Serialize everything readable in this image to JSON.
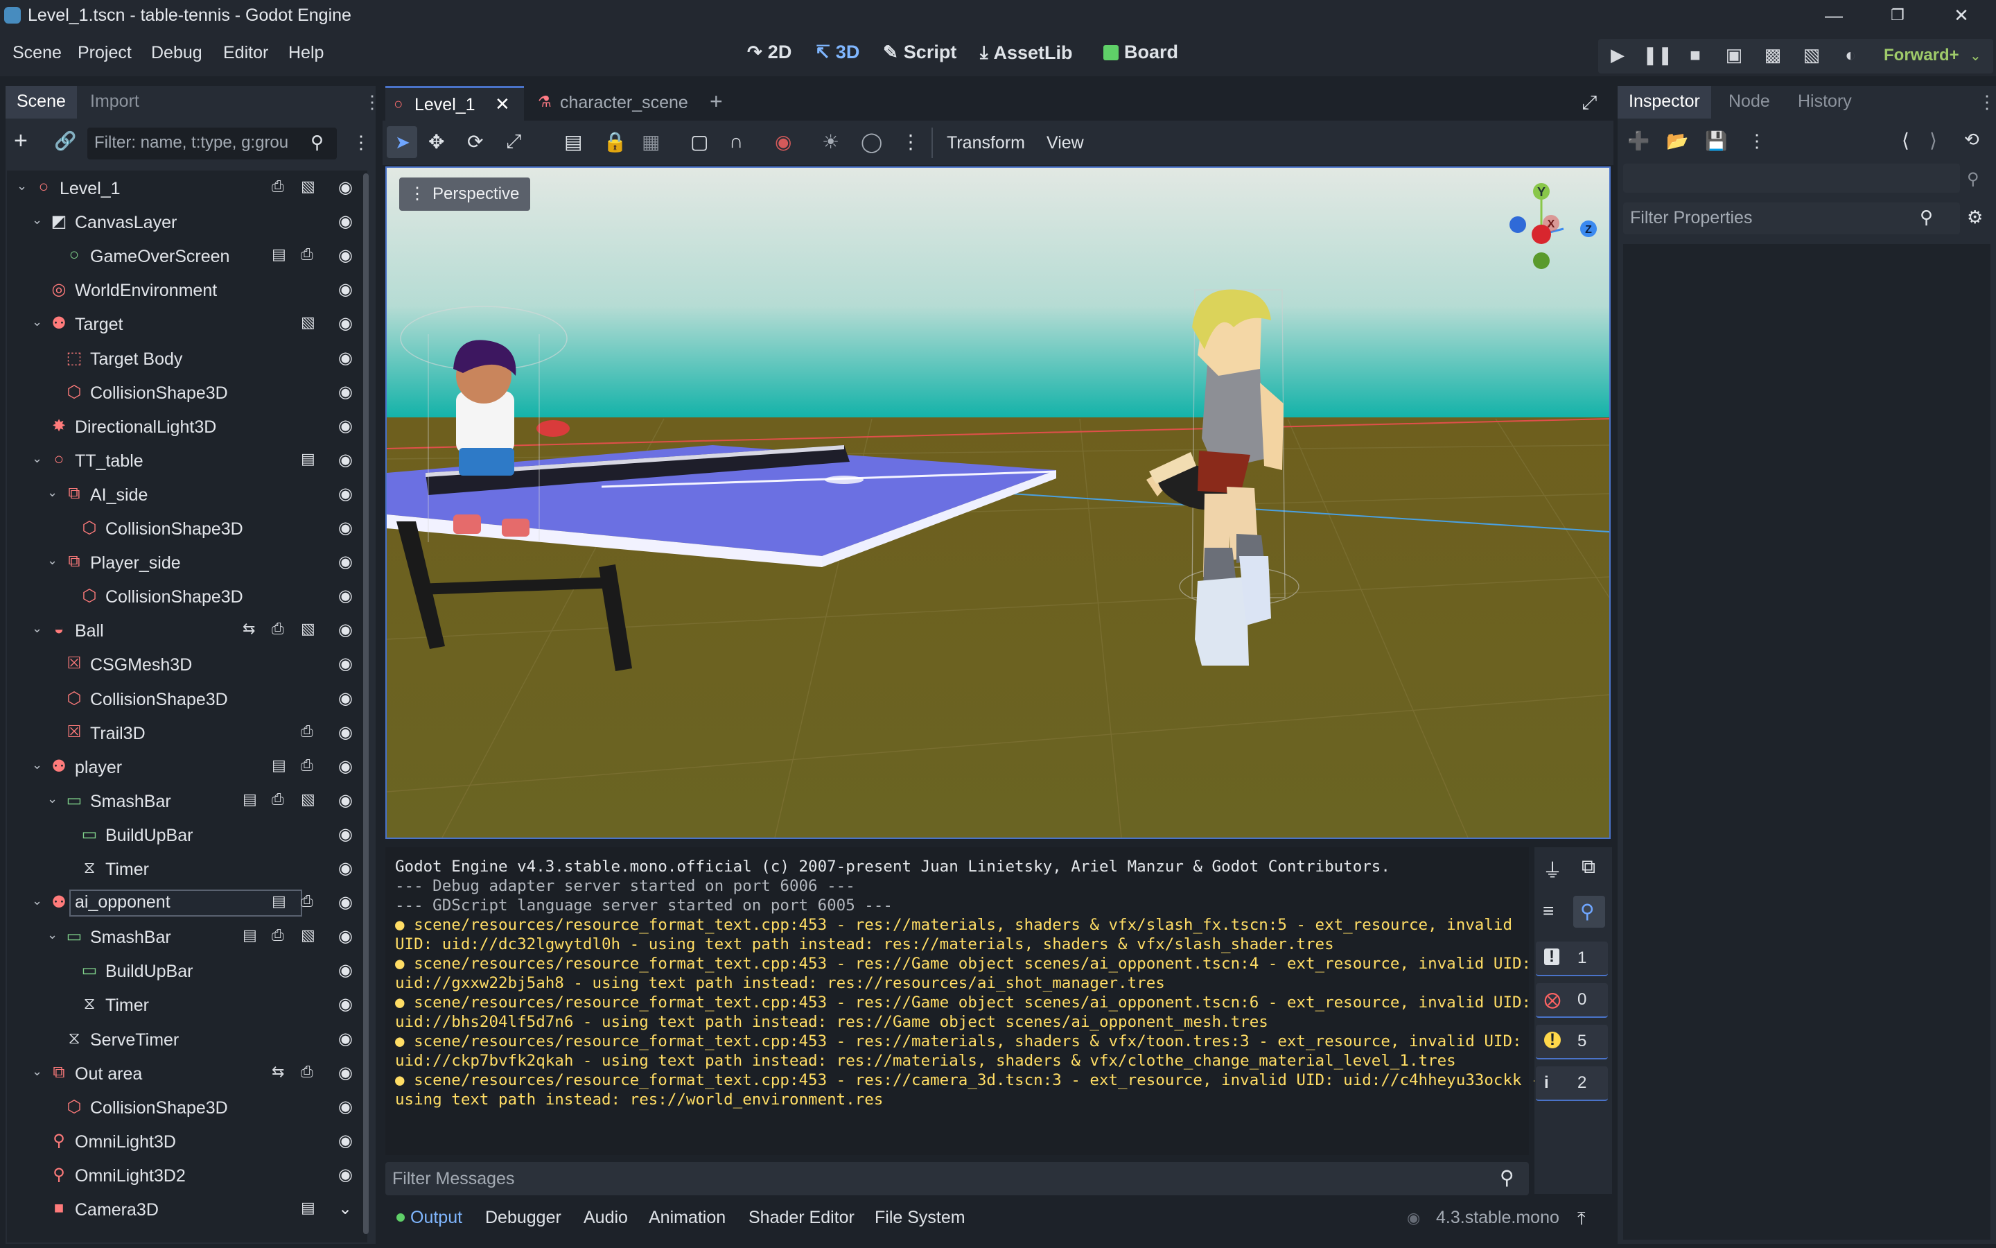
{
  "window": {
    "title": "Level_1.tscn - table-tennis - Godot Engine",
    "minimize_icon": "minimize-icon",
    "maximize_icon": "restore-icon",
    "close_icon": "close-icon"
  },
  "menus": [
    "Scene",
    "Project",
    "Debug",
    "Editor",
    "Help"
  ],
  "workspaces": [
    {
      "label": "2D",
      "icon": "2d-icon"
    },
    {
      "label": "3D",
      "icon": "3d-icon",
      "active": true
    },
    {
      "label": "Script",
      "icon": "script-icon"
    },
    {
      "label": "AssetLib",
      "icon": "assetlib-icon"
    },
    {
      "label": "Board",
      "icon": "board-icon"
    }
  ],
  "renderer": "Forward+",
  "scene_dock": {
    "tabs": [
      "Scene",
      "Import"
    ],
    "filter_placeholder": "Filter: name, t:type, g:grou",
    "tree": [
      {
        "label": "Level_1",
        "icon": "node3d-icon",
        "depth": 0,
        "expanded": true
      },
      {
        "label": "CanvasLayer",
        "icon": "canvaslayer-icon",
        "depth": 1,
        "expanded": true
      },
      {
        "label": "GameOverScreen",
        "icon": "control-icon",
        "depth": 2
      },
      {
        "label": "WorldEnvironment",
        "icon": "worldenv-icon",
        "depth": 1
      },
      {
        "label": "Target",
        "icon": "character-icon",
        "depth": 1,
        "expanded": true
      },
      {
        "label": "Target Body",
        "icon": "staticbody-icon",
        "depth": 2
      },
      {
        "label": "CollisionShape3D",
        "icon": "collision-icon",
        "depth": 2
      },
      {
        "label": "DirectionalLight3D",
        "icon": "light-icon",
        "depth": 1
      },
      {
        "label": "TT_table",
        "icon": "node3d-icon",
        "depth": 1,
        "expanded": true
      },
      {
        "label": "AI_side",
        "icon": "area-icon",
        "depth": 2,
        "expanded": true
      },
      {
        "label": "CollisionShape3D",
        "icon": "collision-icon",
        "depth": 3
      },
      {
        "label": "Player_side",
        "icon": "area-icon",
        "depth": 2,
        "expanded": true
      },
      {
        "label": "CollisionShape3D",
        "icon": "collision-icon",
        "depth": 3
      },
      {
        "label": "Ball",
        "icon": "rigidbody-icon",
        "depth": 1,
        "expanded": true
      },
      {
        "label": "CSGMesh3D",
        "icon": "csgmesh-icon",
        "depth": 2
      },
      {
        "label": "CollisionShape3D",
        "icon": "collision-icon",
        "depth": 2
      },
      {
        "label": "Trail3D",
        "icon": "trail-icon",
        "depth": 2
      },
      {
        "label": "player",
        "icon": "character-icon",
        "depth": 1,
        "expanded": true
      },
      {
        "label": "SmashBar",
        "icon": "progressbar-icon",
        "depth": 2,
        "expanded": true
      },
      {
        "label": "BuildUpBar",
        "icon": "progressbar-icon",
        "depth": 3
      },
      {
        "label": "Timer",
        "icon": "timer-icon",
        "depth": 3
      },
      {
        "label": "ai_opponent",
        "icon": "character-icon",
        "depth": 1,
        "expanded": true,
        "selected": true
      },
      {
        "label": "SmashBar",
        "icon": "progressbar-icon",
        "depth": 2,
        "expanded": true
      },
      {
        "label": "BuildUpBar",
        "icon": "progressbar-icon",
        "depth": 3
      },
      {
        "label": "Timer",
        "icon": "timer-icon",
        "depth": 3
      },
      {
        "label": "ServeTimer",
        "icon": "timer-icon",
        "depth": 2
      },
      {
        "label": "Out area",
        "icon": "area-icon",
        "depth": 1,
        "expanded": true
      },
      {
        "label": "CollisionShape3D",
        "icon": "collision-icon",
        "depth": 2
      },
      {
        "label": "OmniLight3D",
        "icon": "omnilight-icon",
        "depth": 1
      },
      {
        "label": "OmniLight3D2",
        "icon": "omnilight-icon",
        "depth": 1
      },
      {
        "label": "Camera3D",
        "icon": "camera-icon",
        "depth": 1
      }
    ]
  },
  "editor_tabs": [
    {
      "label": "Level_1",
      "active": true
    },
    {
      "label": "character_scene",
      "active": false
    }
  ],
  "viewport_toolbar": {
    "transform_menu": "Transform",
    "view_menu": "View"
  },
  "viewport": {
    "perspective_label": "Perspective",
    "gizmo_axes": [
      "Y",
      "X",
      "Z"
    ]
  },
  "output": {
    "lines": [
      {
        "text": "Godot Engine v4.3.stable.mono.official (c) 2007-present Juan Linietsky, Ariel Manzur & Godot Contributors.",
        "kind": "plain"
      },
      {
        "text": "--- Debug adapter server started on port 6006 ---",
        "kind": "dim"
      },
      {
        "text": "--- GDScript language server started on port 6005 ---",
        "kind": "dim"
      },
      {
        "text": "scene/resources/resource_format_text.cpp:453 - res://materials, shaders & vfx/slash_fx.tscn:5 - ext_resource, invalid",
        "kind": "warn",
        "bullet": true
      },
      {
        "text": "UID: uid://dc32lgwytdl0h - using text path instead: res://materials, shaders & vfx/slash_shader.tres",
        "kind": "warn"
      },
      {
        "text": "scene/resources/resource_format_text.cpp:453 - res://Game object scenes/ai_opponent.tscn:4 - ext_resource, invalid UID:",
        "kind": "warn",
        "bullet": true
      },
      {
        "text": "uid://gxxw22bj5ah8 - using text path instead: res://resources/ai_shot_manager.tres",
        "kind": "warn"
      },
      {
        "text": "scene/resources/resource_format_text.cpp:453 - res://Game object scenes/ai_opponent.tscn:6 - ext_resource, invalid UID:",
        "kind": "warn",
        "bullet": true
      },
      {
        "text": "uid://bhs204lf5d7n6 - using text path instead: res://Game object scenes/ai_opponent_mesh.tres",
        "kind": "warn"
      },
      {
        "text": "scene/resources/resource_format_text.cpp:453 - res://materials, shaders & vfx/toon.tres:3 - ext_resource, invalid UID:",
        "kind": "warn",
        "bullet": true
      },
      {
        "text": "uid://ckp7bvfk2qkah - using text path instead: res://materials, shaders & vfx/clothe_change_material_level_1.tres",
        "kind": "warn"
      },
      {
        "text": "scene/resources/resource_format_text.cpp:453 - res://camera_3d.tscn:3 - ext_resource, invalid UID: uid://c4hheyu33ockk -",
        "kind": "warn",
        "bullet": true
      },
      {
        "text": "using text path instead: res://world_environment.res",
        "kind": "warn"
      }
    ],
    "filter_placeholder": "Filter Messages",
    "counters": {
      "messages": "1",
      "errors": "0",
      "warnings": "5",
      "info": "2"
    }
  },
  "bottom_tabs": [
    "Output",
    "Debugger",
    "Audio",
    "Animation",
    "Shader Editor",
    "File System"
  ],
  "version_label": "4.3.stable.mono",
  "inspector": {
    "tabs": [
      "Inspector",
      "Node",
      "History"
    ],
    "filter_placeholder": "Filter Properties"
  }
}
